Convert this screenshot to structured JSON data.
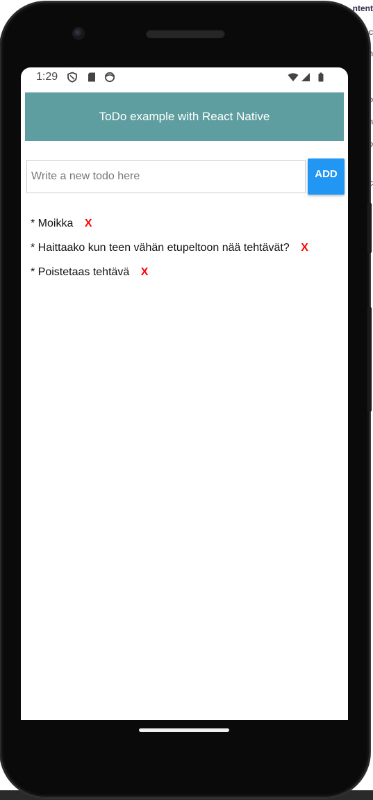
{
  "status_bar": {
    "time": "1:29",
    "left_icons": [
      "shield-icon",
      "sd-card-icon",
      "face-icon"
    ],
    "right_icons": [
      "wifi-icon",
      "signal-icon",
      "battery-icon"
    ]
  },
  "header": {
    "title": "ToDo example with React Native",
    "background": "#5f9ea0"
  },
  "new_todo": {
    "placeholder": "Write a new todo here",
    "value": "",
    "add_label": "ADD",
    "add_color": "#2196f3"
  },
  "todos": [
    {
      "text": "* Moikka",
      "delete_label": "X"
    },
    {
      "text": "* Haittaako kun teen vähän etupeltoon nää tehtävät?",
      "delete_label": "X"
    },
    {
      "text": "* Poistetaas tehtävä",
      "delete_label": "X"
    }
  ],
  "delete_color": "#ff0000",
  "background_page_fragments": [
    "ntent",
    "ec",
    "n",
    "o",
    "n",
    "o",
    "c"
  ]
}
